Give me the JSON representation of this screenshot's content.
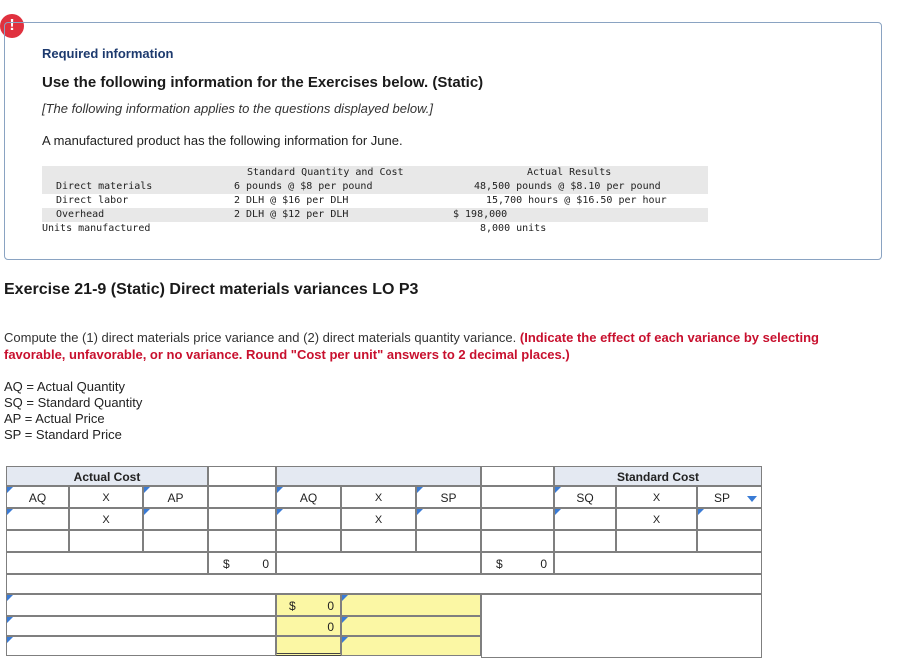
{
  "info": {
    "badge": "!",
    "required_title": "Required information",
    "heading": "Use the following information for the Exercises below. (Static)",
    "note": "[The following information applies to the questions displayed below.]",
    "intro": "A manufactured product has the following information for June.",
    "table": {
      "col_standard": "Standard Quantity and Cost",
      "col_actual": "Actual Results",
      "rows": [
        {
          "label": "Direct materials",
          "standard": "6 pounds @ $8 per pound",
          "actual": "48,500 pounds @ $8.10 per pound"
        },
        {
          "label": "Direct labor",
          "standard": "2 DLH @ $16 per DLH",
          "actual": "15,700 hours @ $16.50 per hour"
        },
        {
          "label": "Overhead",
          "standard": "2 DLH @ $12 per DLH",
          "actual": "$ 198,000"
        },
        {
          "label": "Units manufactured",
          "standard": "",
          "actual": "8,000 units"
        }
      ]
    }
  },
  "exercise": {
    "title": "Exercise 21-9 (Static) Direct materials variances LO P3",
    "instruction_plain": "Compute the (1) direct materials price variance and (2) direct materials quantity variance. ",
    "instruction_red": "(Indicate the effect of each variance by selecting favorable, unfavorable, or no variance. Round \"Cost per unit\" answers to 2 decimal places.)",
    "legend": [
      "AQ = Actual Quantity",
      "SQ = Standard Quantity",
      "AP = Actual Price",
      "SP = Standard Price"
    ]
  },
  "worksheet": {
    "actual_cost_header": "Actual Cost",
    "standard_cost_header": "Standard Cost",
    "aq": "AQ",
    "times": "X",
    "ap": "AP",
    "sp": "SP",
    "sq": "SQ",
    "dollar": "$",
    "total_actual": "0",
    "total_mid": "0",
    "total_standard": "0",
    "variance_1": "0",
    "variance_2": "0"
  }
}
